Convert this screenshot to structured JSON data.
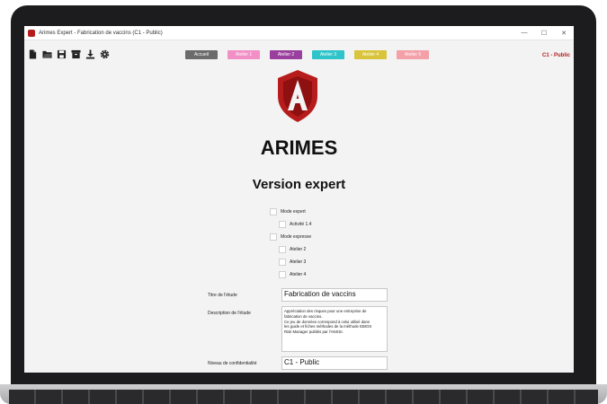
{
  "window": {
    "title": "Arimes Expert - Fabrication de vaccins (C1 - Public)",
    "minimize": "—",
    "maximize": "☐",
    "close": "✕"
  },
  "toolbar": {
    "tools": [
      {
        "name": "new-file-icon"
      },
      {
        "name": "open-folder-icon"
      },
      {
        "name": "save-icon"
      },
      {
        "name": "archive-icon"
      },
      {
        "name": "download-icon"
      },
      {
        "name": "gear-icon"
      }
    ]
  },
  "tabs": [
    {
      "label": "Accueil",
      "color": "#6b6b6b"
    },
    {
      "label": "Atelier 1",
      "color": "#f28fc6"
    },
    {
      "label": "Atelier 2",
      "color": "#9b3f9e"
    },
    {
      "label": "Atelier 3",
      "color": "#2fc4c9"
    },
    {
      "label": "Atelier 4",
      "color": "#d9c43b"
    },
    {
      "label": "Atelier 5",
      "color": "#f4a0a8"
    }
  ],
  "classification": "C1 - Public",
  "brand": {
    "name": "ARIMES",
    "version": "Version expert",
    "logo_color": "#b71c1c"
  },
  "options": {
    "mode_expert": "Mode expert",
    "activite": "Activité 1.4",
    "mode_expresse": "Mode expresse",
    "atelier2": "Atelier 2",
    "atelier3": "Atelier 3",
    "atelier4": "Atelier 4"
  },
  "form": {
    "titre_label": "Titre de l'étude",
    "titre_value": "Fabrication de vaccins",
    "description_label": "Description de l'étude",
    "description_value": "Appréciation des risques pour une entreprise de\nfabrication de vaccins.\nCe jeu de données correspond à celui utilisé dans\nles guide et fiches méthodes de la méthode EBIOS\nRisk Manager publiés par l'ANSSI.",
    "niveau_label": "Niveau de confidentialité",
    "niveau_value": "C1 - Public"
  }
}
